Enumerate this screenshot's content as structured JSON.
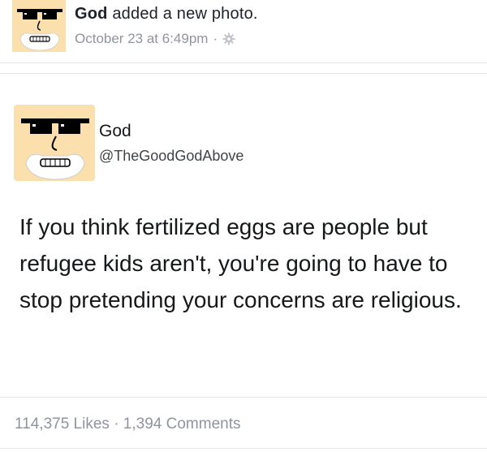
{
  "post": {
    "author": "God",
    "action": "added a new photo.",
    "timestamp": "October 23 at 6:49pm",
    "separator": "·",
    "privacy_icon": "gear-icon",
    "avatar_icon": "cartoon-face-with-pixel-sunglasses"
  },
  "photo": {
    "tweet": {
      "name": "God",
      "handle": "@TheGoodGodAbove",
      "text": "If you think fertilized eggs are people but refugee kids aren't, you're going to have to stop pretending your concerns are religious."
    }
  },
  "stats": {
    "likes": "114,375 Likes",
    "separator": "·",
    "comments": "1,394 Comments"
  },
  "colors": {
    "meta_gray": "#90949c",
    "avatar_skin": "#fbe0ae",
    "text_dark": "#1d2129"
  }
}
